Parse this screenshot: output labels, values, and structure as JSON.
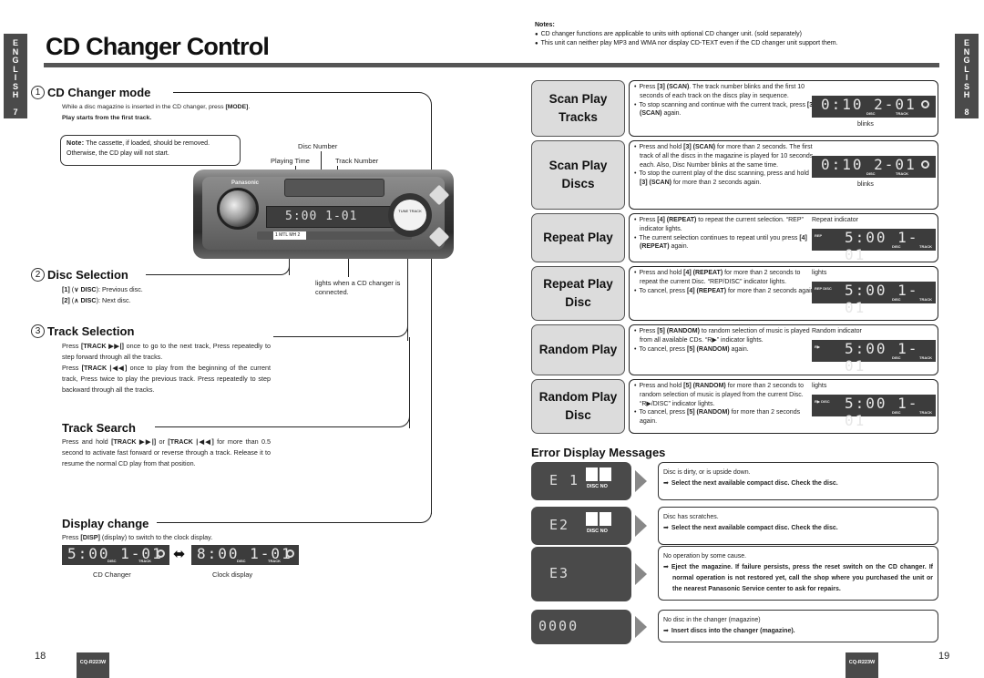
{
  "left_page": {
    "lang_tab": {
      "letters": [
        "E",
        "N",
        "G",
        "L",
        "I",
        "S",
        "H"
      ],
      "page": "7"
    },
    "title": "CD Changer Control",
    "sections": {
      "cd_changer_mode": {
        "num": "1",
        "heading": "CD Changer mode",
        "line1_pre": "While a disc magazine is inserted in the CD changer, press ",
        "line1_key": "[MODE]",
        "line1_post": ".",
        "line2": "Play starts from the first track."
      },
      "note": {
        "label": "Note:",
        "text": " The cassette, if loaded, should be removed. Otherwise, the CD play will not start."
      },
      "diagram_labels": {
        "disc_number": "Disc Number",
        "playing_time": "Playing Time",
        "track_number": "Track Number",
        "lights_when": "lights when a CD changer is connected."
      },
      "radio": {
        "brand": "Panasonic",
        "lcd_text": "5:00  1-01",
        "preset_1": "1 MTL   MH 2",
        "ring_label": "TUNE TRACK"
      },
      "disc_selection": {
        "num": "2",
        "heading": "Disc Selection",
        "items": [
          {
            "key": "[1]",
            "arrow": "∨",
            "label": "DISC",
            "desc": ": Previous disc."
          },
          {
            "key": "[2]",
            "arrow": "∧",
            "label": "DISC",
            "desc": ": Next disc."
          }
        ]
      },
      "track_selection": {
        "num": "3",
        "heading": "Track Selection",
        "p1_pre": "Press ",
        "p1_key": "[TRACK ▶▶|]",
        "p1_post": " once to go to the next track, Press repeatedly to step forward through all the tracks.",
        "p2_pre": "Press ",
        "p2_key": "[TRACK |◀◀]",
        "p2_post": " once to play from the beginning of the current track, Press twice to play the previous track. Press repeatedly to step backward through all the tracks."
      },
      "track_search": {
        "heading": "Track Search",
        "pre": "Press and hold ",
        "key1": "[TRACK ▶▶|]",
        "mid": " or ",
        "key2": "[TRACK |◀◀]",
        "post": " for more than 0.5 second to activate fast forward or reverse through a track. Release it to resume the normal CD play from that position."
      },
      "display_change": {
        "heading": "Display change",
        "pre": "Press ",
        "key": "[DISP]",
        "post": " (display) to switch to the clock display.",
        "cd_display": "5:00  1-01",
        "clock_display": "8:00  1-01",
        "disc_label": "DISC",
        "track_label": "TRACK",
        "arrow": "⬌",
        "caption_cd": "CD Changer",
        "caption_clock": "Clock display"
      }
    },
    "page_number": "18",
    "model": "CQ-R223W"
  },
  "right_page": {
    "lang_tab": {
      "letters": [
        "E",
        "N",
        "G",
        "L",
        "I",
        "S",
        "H"
      ],
      "page": "8"
    },
    "notes": {
      "heading": "Notes:",
      "items": [
        "CD changer functions are applicable to units with optional CD changer unit. (sold separately)",
        "This unit can neither play MP3 and WMA nor display CD-TEXT even if the CD changer unit support them."
      ]
    },
    "functions": [
      {
        "label1": "Scan Play",
        "label2": "Tracks",
        "bullets": [
          {
            "pre": "Press ",
            "key": "[3] (SCAN)",
            "post": ". The track number blinks and the first 10 seconds of each track on the discs play in sequence."
          },
          {
            "pre": "To stop scanning and continue with the current track, press ",
            "key": "[3] (SCAN)",
            "post": " again."
          }
        ],
        "display": "0:10  2-01",
        "indicator": "",
        "annotation": "blinks"
      },
      {
        "label1": "Scan Play",
        "label2": "Discs",
        "bullets": [
          {
            "pre": "Press and hold ",
            "key": "[3] (SCAN)",
            "post": " for more than 2 seconds. The first track of all the discs in the magazine is played for 10 seconds each. Also, Disc Number blinks at the same time."
          },
          {
            "pre": "To stop the current play of the disc scanning, press and hold ",
            "key": "[3] (SCAN)",
            "post": " for more than 2 seconds again."
          }
        ],
        "display": "0:10  2-01",
        "indicator": "",
        "annotation": "blinks"
      },
      {
        "label1": "Repeat Play",
        "label2": "",
        "bullets": [
          {
            "pre": "Press ",
            "key": "[4] (REPEAT)",
            "post": " to repeat the current selection. “REP” indicator lights."
          },
          {
            "pre": "The current selection continues to repeat until you press ",
            "key": "[4] (REPEAT)",
            "post": " again."
          }
        ],
        "display": "5:00  1-01",
        "indicator": "REP",
        "annotation": "Repeat indicator"
      },
      {
        "label1": "Repeat Play",
        "label2": "Disc",
        "bullets": [
          {
            "pre": "Press and hold ",
            "key": "[4] (REPEAT)",
            "post": " for more than 2 seconds to repeat the current Disc. “REP/DISC” indicator lights."
          },
          {
            "pre": "To cancel, press ",
            "key": "[4] (REPEAT)",
            "post": " for more than 2 seconds again."
          }
        ],
        "display": "5:00  1-01",
        "indicator": "REP DISC",
        "annotation": "lights"
      },
      {
        "label1": "Random Play",
        "label2": "",
        "bullets": [
          {
            "pre": "Press ",
            "key": "[5] (RANDOM)",
            "post": " to random selection of music is played from all available CDs. “R▶” indicator lights."
          },
          {
            "pre": "To cancel, press ",
            "key": "[5] (RANDOM)",
            "post": " again."
          }
        ],
        "display": "5:00  1-01",
        "indicator": "R▶",
        "annotation": "Random indicator"
      },
      {
        "label1": "Random Play",
        "label2": "Disc",
        "bullets": [
          {
            "pre": "Press and hold ",
            "key": "[5] (RANDOM)",
            "post": " for more than 2 seconds to random selection of  music is played from the current Disc. “R▶/DISC” indicator lights."
          },
          {
            "pre": "To cancel, press ",
            "key": "[5] (RANDOM)",
            "post": " for more than 2 seconds again."
          }
        ],
        "display": "5:00  1-01",
        "indicator": "R▶ DISC",
        "annotation": "lights"
      }
    ],
    "lcd_labels": {
      "disc": "DISC",
      "track": "TRACK"
    },
    "errors": {
      "heading": "Error Display Messages",
      "items": [
        {
          "code": "E 1",
          "disc_no": "DISC NO",
          "cause": "Disc is dirty, or is upside down.",
          "action": "Select the next available compact disc. Check the disc."
        },
        {
          "code": "E2",
          "disc_no": "DISC NO",
          "cause": "Disc has scratches.",
          "action": "Select the next available compact disc. Check the disc."
        },
        {
          "code": "E3",
          "disc_no": "",
          "cause": "No operation by some cause.",
          "action": "Eject the magazine. If failure persists, press the reset switch on the CD changer. If normal operation is not restored yet, call the shop where you purchased the unit or the nearest Panasonic Service center to ask for repairs."
        },
        {
          "code": "0000",
          "disc_no": "",
          "cause": "No disc in the changer (magazine)",
          "action": "Insert discs into the changer (magazine)."
        }
      ]
    },
    "page_number": "19",
    "model": "CQ-R223W"
  }
}
